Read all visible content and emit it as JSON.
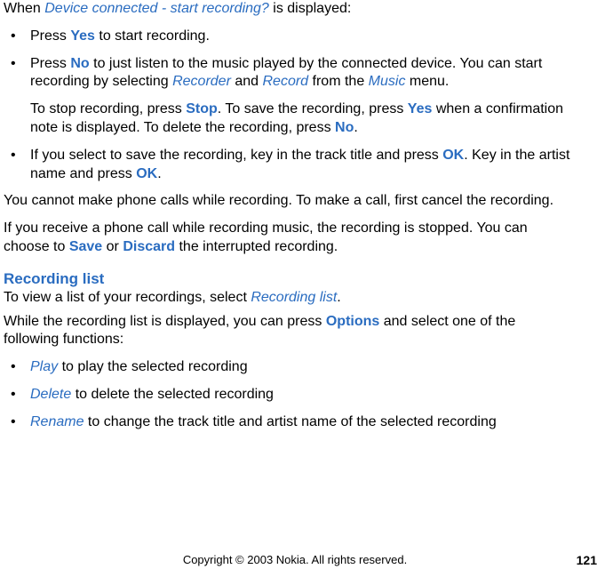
{
  "intro": {
    "prefix": "When ",
    "prompt": "Device connected - start recording?",
    "suffix": " is displayed:"
  },
  "bullets1": [
    {
      "p1": {
        "pre": "Press ",
        "k1": "Yes",
        "post": " to start recording."
      }
    },
    {
      "p1": {
        "pre": "Press ",
        "k1": "No",
        "mid1": " to just listen to the music played by the connected device. You can start recording by selecting ",
        "k2": "Recorder",
        "mid2": " and ",
        "k3": "Record",
        "mid3": " from the ",
        "k4": "Music",
        "post": " menu."
      },
      "p2": {
        "pre": "To stop recording, press ",
        "k1": "Stop",
        "mid1": ". To save the recording, press ",
        "k2": "Yes",
        "mid2": " when a confirmation note is displayed. To delete the recording, press ",
        "k3": "No",
        "post": "."
      }
    },
    {
      "p1": {
        "pre": "If you select to save the recording, key in the track title and press ",
        "k1": "OK",
        "mid1": ". Key in the artist name and press ",
        "k2": "OK",
        "post": "."
      }
    }
  ],
  "para_cannot": "You cannot make phone calls while recording. To make a call, first cancel the recording.",
  "para_receive": {
    "pre": "If you receive a phone call while recording music, the recording is stopped. You can choose to ",
    "k1": "Save",
    "mid": " or ",
    "k2": "Discard",
    "post": " the interrupted recording."
  },
  "section": {
    "head": "Recording list",
    "intro": {
      "pre": "To view a list of your recordings, select ",
      "k1": "Recording list",
      "post": "."
    },
    "lead": {
      "pre": "While the recording list is displayed, you can press ",
      "k1": "Options",
      "post": " and select one of the following functions:"
    }
  },
  "bullets2": [
    {
      "k": "Play",
      "txt": " to play the selected recording"
    },
    {
      "k": "Delete",
      "txt": " to delete the selected recording"
    },
    {
      "k": "Rename",
      "txt": " to change the track title and artist name of the selected recording"
    }
  ],
  "footer": {
    "copyright": "Copyright © 2003 Nokia. All rights reserved.",
    "page": "121"
  }
}
